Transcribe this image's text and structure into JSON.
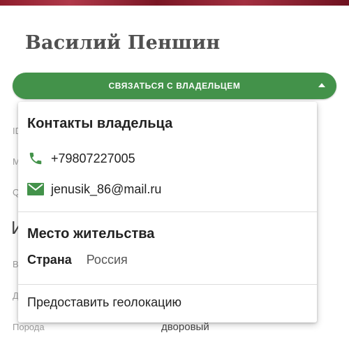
{
  "owner": {
    "name": "Василий Пеншин"
  },
  "contact_button": {
    "label": "СВЯЗАТЬСЯ С ВЛАДЕЛЬЦЕМ"
  },
  "background": {
    "label_1": "ID",
    "label_2": "M",
    "label_3": "Q",
    "heading": "И",
    "label_4": "В",
    "label_5": "Д",
    "breed_label": "Порода",
    "breed_value": "дворовый"
  },
  "dropdown": {
    "contacts_title": "Контакты владельца",
    "phone": "+79807227005",
    "email": "jenusik_86@mail.ru",
    "residence_title": "Место жительства",
    "country_label": "Страна",
    "country_value": "Россия",
    "geo_link": "Предоставить геолокацию"
  },
  "colors": {
    "accent_green": "#43924a"
  },
  "icons": {
    "phone": "phone-icon",
    "email": "email-icon",
    "arrow": "chevron-up-icon"
  }
}
